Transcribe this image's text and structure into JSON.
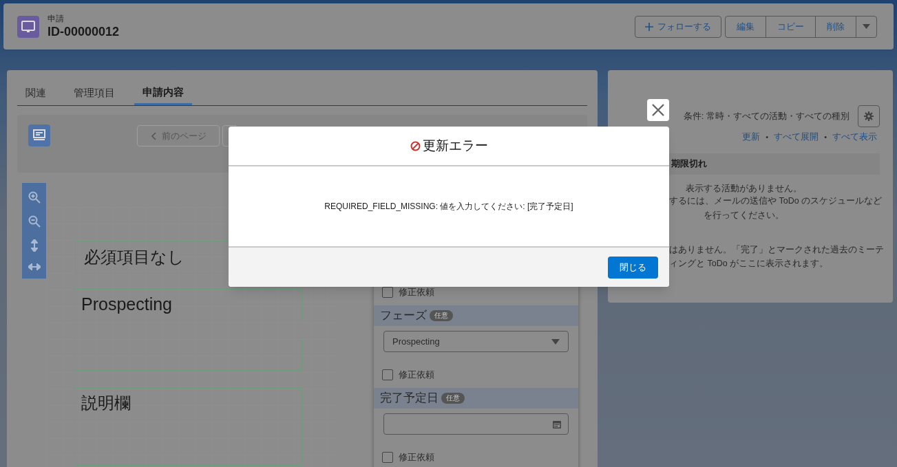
{
  "record": {
    "object_label": "申請",
    "name": "ID-00000012"
  },
  "header_actions": {
    "follow": "フォローする",
    "buttons": [
      "編集",
      "コピー",
      "削除"
    ]
  },
  "tabs": [
    {
      "label": "関連",
      "selected": false
    },
    {
      "label": "管理項目",
      "selected": false
    },
    {
      "label": "申請内容",
      "selected": true
    }
  ],
  "toolbar": {
    "prev_page": "前のページ"
  },
  "canvas": {
    "title_box": "必須項目なし",
    "phase_box": "Prospecting",
    "description_box": "説明欄"
  },
  "form": {
    "items": [
      {
        "kind": "checkbox",
        "label": "修正依頼",
        "checked": false
      },
      {
        "kind": "section",
        "label": "フェーズ",
        "badge": "任意"
      },
      {
        "kind": "select",
        "value": "Prospecting"
      },
      {
        "kind": "checkbox",
        "label": "修正依頼",
        "checked": false
      },
      {
        "kind": "section",
        "label": "完了予定日",
        "badge": "任意"
      },
      {
        "kind": "date"
      },
      {
        "kind": "checkbox",
        "label": "修正依頼",
        "checked": false
      }
    ]
  },
  "activity": {
    "filter": "条件: 常時・すべての活動・すべての種別",
    "links": [
      "更新",
      "すべて展開",
      "すべて表示"
    ],
    "separator": "•",
    "section": "期限切れ",
    "empty_title": "表示する活動がありません。",
    "empty_hint_start": "するには、メールの送信や ToDo のスケジュールなど",
    "empty_hint_end": "を行ってください。",
    "past_lines": [
      "はありません。「完了」とマークされた過去のミーテ",
      "ィングと ToDo がここに表示されます。"
    ]
  },
  "modal": {
    "title": "更新エラー",
    "message": "REQUIRED_FIELD_MISSING: 値を入力してください: [完了予定日]",
    "close_button": "閉じる"
  }
}
